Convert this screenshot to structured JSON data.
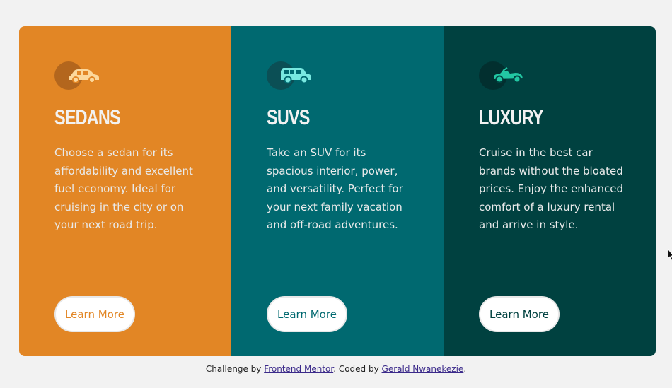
{
  "cards": [
    {
      "icon": "sedan-car-icon",
      "title": "SEDANS",
      "text": "Choose a sedan for its affordability and excellent fuel economy. Ideal for cruising in the city or on your next road trip.",
      "button": "Learn More",
      "color": "#e28625"
    },
    {
      "icon": "suv-car-icon",
      "title": "SUVS",
      "text": "Take an SUV for its spacious interior, power, and versatility. Perfect for your next family vacation and off-road adventures.",
      "button": "Learn More",
      "color": "#006970"
    },
    {
      "icon": "luxury-car-icon",
      "title": "LUXURY",
      "text": "Cruise in the best car brands without the bloated prices. Enjoy the enhanced comfort of a luxury rental and arrive in style.",
      "button": "Learn More",
      "color": "#004140"
    }
  ],
  "footer": {
    "prefix": "Challenge by ",
    "link1": "Frontend Mentor",
    "middle": ". Coded by ",
    "link2": "Gerald Nwanekezie",
    "suffix": "."
  }
}
